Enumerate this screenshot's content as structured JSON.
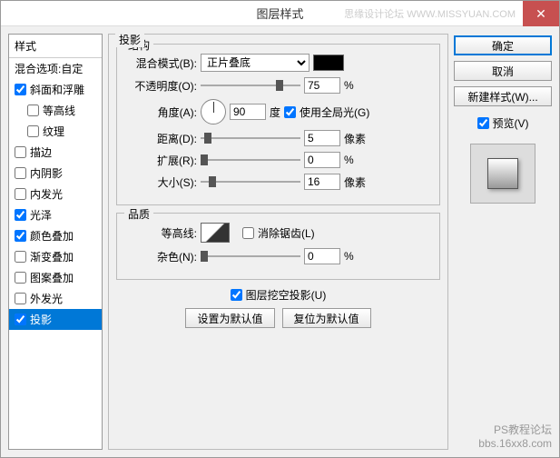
{
  "window": {
    "title": "图层样式"
  },
  "watermark": {
    "top": "思缘设计论坛 WWW.MISSYUAN.COM",
    "bottom1": "PS教程论坛",
    "bottom2": "bbs.16xx8.com"
  },
  "sidebar": {
    "header": "样式",
    "blend_options": "混合选项:自定",
    "items": [
      {
        "label": "斜面和浮雕",
        "checked": true
      },
      {
        "label": "等高线",
        "checked": false,
        "indent": true
      },
      {
        "label": "纹理",
        "checked": false,
        "indent": true
      },
      {
        "label": "描边",
        "checked": false
      },
      {
        "label": "内阴影",
        "checked": false
      },
      {
        "label": "内发光",
        "checked": false
      },
      {
        "label": "光泽",
        "checked": true
      },
      {
        "label": "颜色叠加",
        "checked": true
      },
      {
        "label": "渐变叠加",
        "checked": false
      },
      {
        "label": "图案叠加",
        "checked": false
      },
      {
        "label": "外发光",
        "checked": false
      },
      {
        "label": "投影",
        "checked": true,
        "selected": true
      }
    ]
  },
  "main": {
    "title": "投影",
    "structure": {
      "legend": "结构",
      "blend_mode_label": "混合模式(B):",
      "blend_mode_value": "正片叠底",
      "opacity_label": "不透明度(O):",
      "opacity_value": "75",
      "pct": "%",
      "angle_label": "角度(A):",
      "angle_value": "90",
      "angle_unit": "度",
      "global_light_label": "使用全局光(G)",
      "distance_label": "距离(D):",
      "distance_value": "5",
      "px": "像素",
      "spread_label": "扩展(R):",
      "spread_value": "0",
      "size_label": "大小(S):",
      "size_value": "16"
    },
    "quality": {
      "legend": "品质",
      "contour_label": "等高线:",
      "antialias_label": "消除锯齿(L)",
      "noise_label": "杂色(N):",
      "noise_value": "0",
      "pct": "%"
    },
    "knockout_label": "图层挖空投影(U)",
    "reset_default": "设置为默认值",
    "restore_default": "复位为默认值"
  },
  "buttons": {
    "ok": "确定",
    "cancel": "取消",
    "new_style": "新建样式(W)...",
    "preview": "预览(V)"
  }
}
